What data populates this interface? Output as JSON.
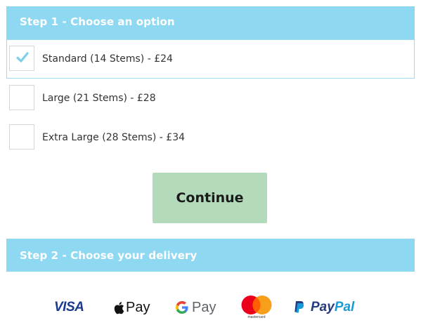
{
  "step1": {
    "title": "Step 1 - Choose an option",
    "options": [
      {
        "label": "Standard (14 Stems) - £24",
        "selected": true
      },
      {
        "label": "Large (21 Stems) - £28",
        "selected": false
      },
      {
        "label": "Extra Large (28 Stems) - £34",
        "selected": false
      }
    ]
  },
  "continue_label": "Continue",
  "step2": {
    "title": "Step 2 - Choose your delivery"
  },
  "payments": {
    "visa": "VISA",
    "apple_pay": "Pay",
    "google_pay": "Pay",
    "mastercard": "mastercard",
    "paypal_1": "Pay",
    "paypal_2": "Pal"
  },
  "colors": {
    "header_bg": "#8fd8f2",
    "checkmark": "#7fcfe8",
    "continue_bg": "#b3dbbb"
  }
}
